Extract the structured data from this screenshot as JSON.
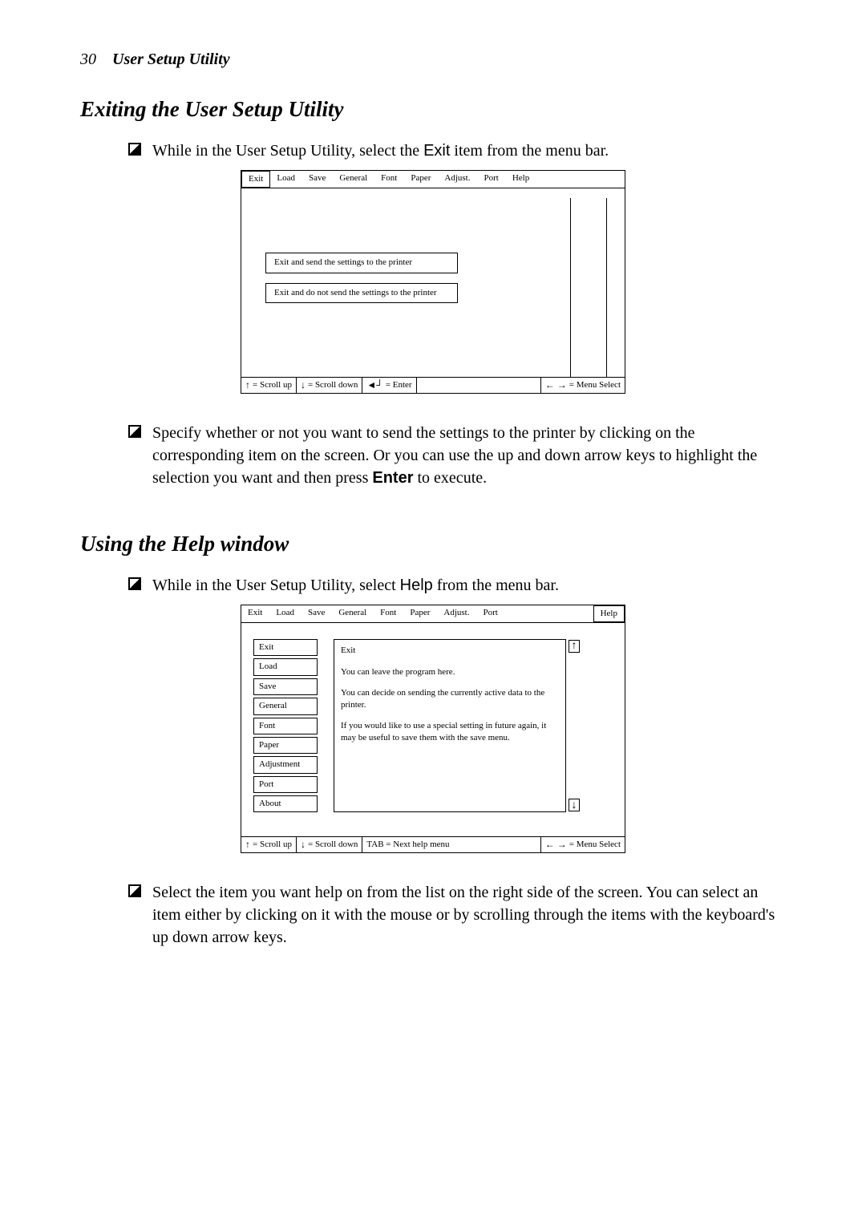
{
  "page": {
    "number": "30",
    "header": "User Setup Utility"
  },
  "section1": {
    "heading": "Exiting the User Setup Utility",
    "bullet1_a": "While in the User Setup Utility, select the ",
    "bullet1_exit": "Exit",
    "bullet1_b": " item from the menu bar.",
    "bullet2_a": "Specify whether or not you want to send the settings to the printer by clicking on the corresponding item on the screen. Or you can use the up and down arrow keys to highlight the selection you want and then press ",
    "bullet2_enter": "Enter",
    "bullet2_b": " to execute."
  },
  "section2": {
    "heading": "Using the Help window",
    "bullet1_a": "While in the User Setup Utility, select ",
    "bullet1_help": "Help",
    "bullet1_b": " from the menu bar.",
    "bullet2": "Select the item you want help on from the list on the right side of the screen. You can select an item either by clicking on it with the mouse or by scrolling through the items with the keyboard's up down arrow keys."
  },
  "dialog1": {
    "menu": [
      "Exit",
      "Load",
      "Save",
      "General",
      "Font",
      "Paper",
      "Adjust.",
      "Port",
      "Help"
    ],
    "option1": "Exit and send the settings to the printer",
    "option2": "Exit and do not send the settings to the printer",
    "status_scrollup": "= Scroll up",
    "status_scrolldown": "= Scroll down",
    "status_enter": "= Enter",
    "status_menuselect": "= Menu Select"
  },
  "dialog2": {
    "menu": [
      "Exit",
      "Load",
      "Save",
      "General",
      "Font",
      "Paper",
      "Adjust.",
      "Port",
      "Help"
    ],
    "listItems": [
      "Exit",
      "Load",
      "Save",
      "General",
      "Font",
      "Paper",
      "Adjustment",
      "Port",
      "About"
    ],
    "detail": {
      "title": "Exit",
      "p1": "You can leave the program here.",
      "p2": "You can decide on sending the currently active data to the printer.",
      "p3": "If you would like to use a special setting in future again, it may be useful to save them with the save menu."
    },
    "status_scrollup": "= Scroll up",
    "status_scrolldown": "= Scroll down",
    "status_tab": "TAB = Next help menu",
    "status_menuselect": "= Menu Select"
  }
}
